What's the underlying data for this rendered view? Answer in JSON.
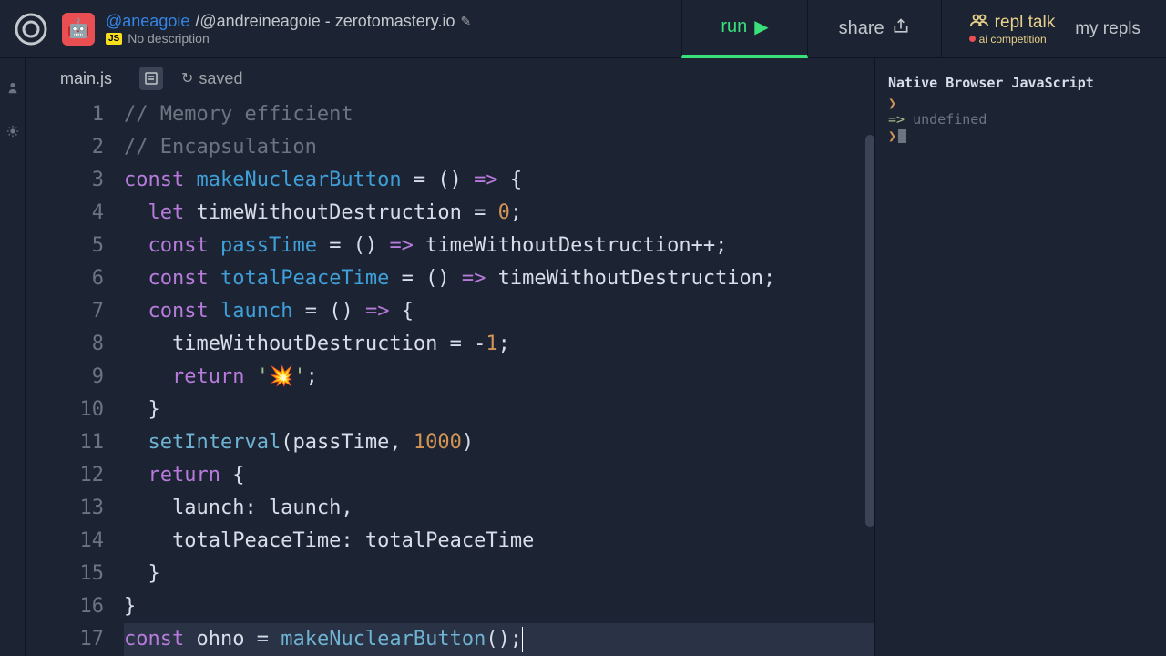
{
  "header": {
    "user": "@aneagoie",
    "project": "@andreineagoie - zerotomastery.io",
    "description": "No description",
    "js_badge": "JS",
    "run": "run",
    "share": "share",
    "repl_talk": "repl talk",
    "repl_talk_sub": "ai competition",
    "my_repls": "my repls"
  },
  "tabs": {
    "file": "main.js",
    "saved": "saved"
  },
  "code": {
    "lines": [
      {
        "n": "1",
        "tokens": [
          [
            "com",
            "// Memory efficient"
          ]
        ]
      },
      {
        "n": "2",
        "tokens": [
          [
            "com",
            "// Encapsulation"
          ]
        ]
      },
      {
        "n": "3",
        "tokens": [
          [
            "kw",
            "const "
          ],
          [
            "fn",
            "makeNuclearButton"
          ],
          [
            "op",
            " = () "
          ],
          [
            "kw",
            "=>"
          ],
          [
            "op",
            " {"
          ]
        ]
      },
      {
        "n": "4",
        "tokens": [
          [
            "op",
            "  "
          ],
          [
            "kw",
            "let "
          ],
          [
            "def",
            "timeWithoutDestruction"
          ],
          [
            "op",
            " = "
          ],
          [
            "num",
            "0"
          ],
          [
            "op",
            ";"
          ]
        ]
      },
      {
        "n": "5",
        "tokens": [
          [
            "op",
            "  "
          ],
          [
            "kw",
            "const "
          ],
          [
            "fn",
            "passTime"
          ],
          [
            "op",
            " = () "
          ],
          [
            "kw",
            "=>"
          ],
          [
            "op",
            " timeWithoutDestruction++;"
          ]
        ]
      },
      {
        "n": "6",
        "tokens": [
          [
            "op",
            "  "
          ],
          [
            "kw",
            "const "
          ],
          [
            "fn",
            "totalPeaceTime"
          ],
          [
            "op",
            " = () "
          ],
          [
            "kw",
            "=>"
          ],
          [
            "op",
            " timeWithoutDestruction;"
          ]
        ]
      },
      {
        "n": "7",
        "tokens": [
          [
            "op",
            "  "
          ],
          [
            "kw",
            "const "
          ],
          [
            "fn",
            "launch"
          ],
          [
            "op",
            " = () "
          ],
          [
            "kw",
            "=>"
          ],
          [
            "op",
            " {"
          ]
        ]
      },
      {
        "n": "8",
        "tokens": [
          [
            "op",
            "    timeWithoutDestruction = "
          ],
          [
            "op",
            "-"
          ],
          [
            "num",
            "1"
          ],
          [
            "op",
            ";"
          ]
        ]
      },
      {
        "n": "9",
        "tokens": [
          [
            "op",
            "    "
          ],
          [
            "kw",
            "return "
          ],
          [
            "str",
            "'💥'"
          ],
          [
            "op",
            ";"
          ]
        ]
      },
      {
        "n": "10",
        "tokens": [
          [
            "op",
            "  }"
          ]
        ]
      },
      {
        "n": "11",
        "tokens": [
          [
            "op",
            "  "
          ],
          [
            "call",
            "setInterval"
          ],
          [
            "op",
            "(passTime, "
          ],
          [
            "num",
            "1000"
          ],
          [
            "op",
            ")"
          ]
        ]
      },
      {
        "n": "12",
        "tokens": [
          [
            "op",
            "  "
          ],
          [
            "kw",
            "return"
          ],
          [
            "op",
            " {"
          ]
        ]
      },
      {
        "n": "13",
        "tokens": [
          [
            "op",
            "    launch: launch,"
          ]
        ]
      },
      {
        "n": "14",
        "tokens": [
          [
            "op",
            "    totalPeaceTime: totalPeaceTime"
          ]
        ]
      },
      {
        "n": "15",
        "tokens": [
          [
            "op",
            "  }"
          ]
        ]
      },
      {
        "n": "16",
        "tokens": [
          [
            "op",
            "}"
          ]
        ]
      },
      {
        "n": "17",
        "hl": true,
        "tokens": [
          [
            "kw",
            "const "
          ],
          [
            "def",
            "ohno"
          ],
          [
            "op",
            " = "
          ],
          [
            "call",
            "makeNuclearButton"
          ],
          [
            "op",
            "();"
          ]
        ],
        "cursor": true
      }
    ]
  },
  "console": {
    "title": "Native Browser JavaScript",
    "result": "undefined"
  }
}
